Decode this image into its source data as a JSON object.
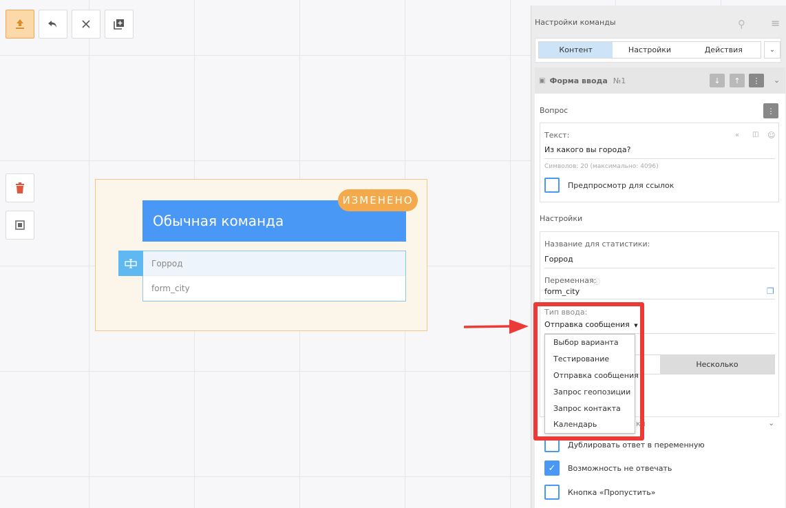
{
  "toolbar": {
    "publish_icon": "upload-icon",
    "undo_icon": "undo-icon",
    "close_icon": "close-icon",
    "add_icon": "add-copy-icon"
  },
  "side_tools": {
    "delete_icon": "trash-icon",
    "fit_icon": "frame-icon"
  },
  "block": {
    "badge": "ИЗМЕНЕНО",
    "title": "Обычная команда",
    "input_label": "Горрод",
    "input_var": "form_city"
  },
  "panel": {
    "title": "Настройки команды",
    "tabs": [
      {
        "label": "Контент",
        "active": true
      },
      {
        "label": "Настройки",
        "active": false
      },
      {
        "label": "Действия",
        "active": false
      }
    ],
    "section": {
      "title": "Форма ввода",
      "number": "№1"
    },
    "question": {
      "heading": "Вопрос",
      "text_label": "Текст:",
      "text_value": "Из какого вы города?",
      "counter": "Символов: 20 (максимально: 4096)",
      "preview_label": "Предпросмотр для ссылок"
    },
    "settings": {
      "heading": "Настройки",
      "stat_label": "Название для статистики:",
      "stat_value": "Горрод",
      "var_label": "Переменная:",
      "var_value": "form_city",
      "type_label": "Тип ввода:",
      "type_value": "Отправка сообщения",
      "segment_right": "Несколько",
      "partial_text": "ки"
    },
    "dropdown_options": [
      "Выбор варианта",
      "Тестирование",
      "Отправка сообщения",
      "Запрос геопозиции",
      "Запрос контакта",
      "Календарь"
    ],
    "checkboxes": [
      {
        "label": "Дублировать ответ в переменную",
        "checked": false
      },
      {
        "label": "Возможность не отвечать",
        "checked": true
      },
      {
        "label": "Кнопка «Пропустить»",
        "checked": false
      }
    ]
  },
  "colors": {
    "accent": "#4a98f6",
    "badge": "#f4a94a",
    "highlight": "#ea3b36"
  }
}
